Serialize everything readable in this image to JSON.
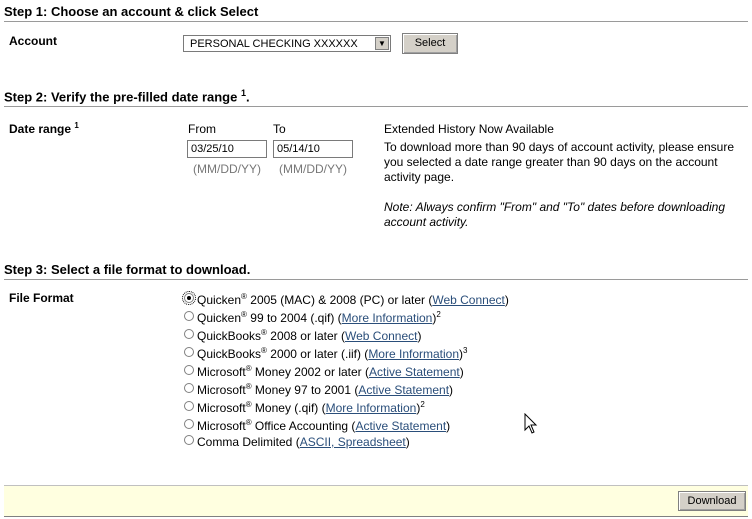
{
  "step1": {
    "heading": "Step 1: Choose an account & click Select",
    "account_label": "Account",
    "account_value": "PERSONAL CHECKING XXXXXX",
    "select_button": "Select"
  },
  "step2": {
    "heading": "Step 2: Verify the pre-filled date range",
    "heading_sup": "1",
    "heading_end": ".",
    "date_label": "Date range",
    "date_label_sup": "1",
    "from_label": "From",
    "to_label": "To",
    "from_value": "03/25/10",
    "to_value": "05/14/10",
    "from_hint": "(MM/DD/YY)",
    "to_hint": "(MM/DD/YY)",
    "info_title": "Extended History Now Available",
    "info_body": "To download more than 90 days of account activity, please ensure you selected a date range greater than 90 days on the account activity page.",
    "info_note": "Note: Always confirm \"From\" and \"To\" dates before downloading account activity."
  },
  "step3": {
    "heading": "Step 3: Select a file format to download.",
    "format_label": "File Format",
    "options": [
      {
        "pre": "Quicken",
        "reg": "®",
        "post": " 2005 (MAC) & 2008 (PC) or later (",
        "link": "Web Connect",
        "close": ")",
        "sup": "",
        "checked": true
      },
      {
        "pre": "Quicken",
        "reg": "®",
        "post": " 99 to 2004 (.qif) (",
        "link": "More Information",
        "close": ")",
        "sup": "2",
        "checked": false
      },
      {
        "pre": "QuickBooks",
        "reg": "®",
        "post": " 2008 or later (",
        "link": "Web Connect",
        "close": ")",
        "sup": "",
        "checked": false
      },
      {
        "pre": "QuickBooks",
        "reg": "®",
        "post": " 2000 or later (.iif) (",
        "link": "More Information",
        "close": ")",
        "sup": "3",
        "checked": false
      },
      {
        "pre": "Microsoft",
        "reg": "®",
        "post": " Money 2002 or later (",
        "link": "Active Statement",
        "close": ")",
        "sup": "",
        "checked": false
      },
      {
        "pre": "Microsoft",
        "reg": "®",
        "post": " Money 97 to 2001 (",
        "link": "Active Statement",
        "close": ")",
        "sup": "",
        "checked": false
      },
      {
        "pre": "Microsoft",
        "reg": "®",
        "post": " Money (.qif) (",
        "link": "More Information",
        "close": ")",
        "sup": "2",
        "checked": false
      },
      {
        "pre": "Microsoft",
        "reg": "®",
        "post": " Office Accounting (",
        "link": "Active Statement",
        "close": ")",
        "sup": "",
        "checked": false
      },
      {
        "pre": "Comma Delimited",
        "reg": "",
        "post": " (",
        "link": "ASCII, Spreadsheet",
        "close": ")",
        "sup": "",
        "checked": false
      }
    ]
  },
  "footer": {
    "download_button": "Download"
  }
}
